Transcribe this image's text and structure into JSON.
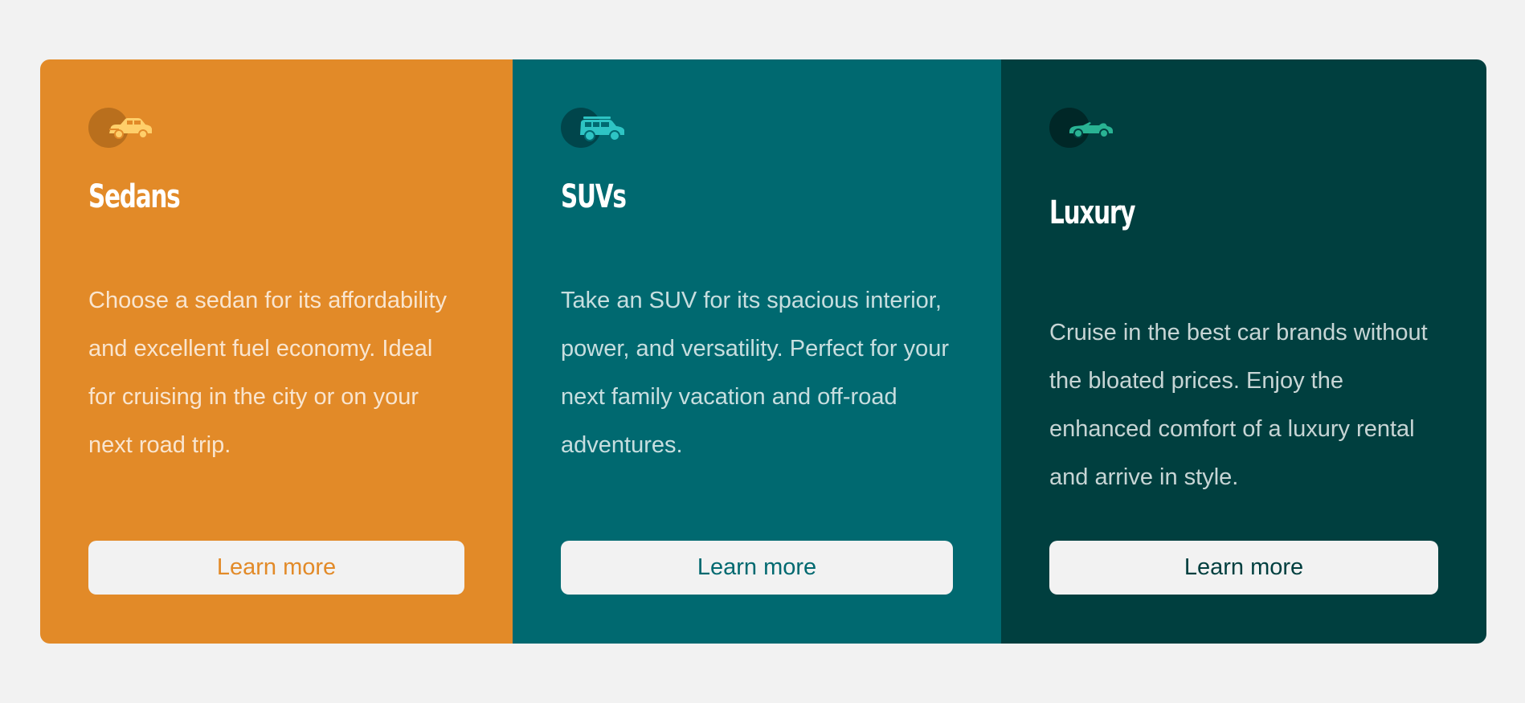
{
  "cards": [
    {
      "icon": "sedan-car-icon",
      "title": "Sedans",
      "description": "Choose a sedan for its affordability and excellent fuel economy. Ideal for cruising in the city or on your next road trip.",
      "button_label": "Learn more",
      "color": "#e28a28"
    },
    {
      "icon": "suv-car-icon",
      "title": "SUVs",
      "description": "Take an SUV for its spacious interior, power, and versatility. Perfect for your next family vacation and off-road adventures.",
      "button_label": "Learn more",
      "color": "#006970"
    },
    {
      "icon": "luxury-car-icon",
      "title": "Luxury",
      "description": "Cruise in the best car brands without the bloated prices. Enjoy the enhanced comfort of a luxury rental and arrive in style.",
      "button_label": "Learn more",
      "color": "#003f3f"
    }
  ],
  "background_color": "#f2f2f2"
}
